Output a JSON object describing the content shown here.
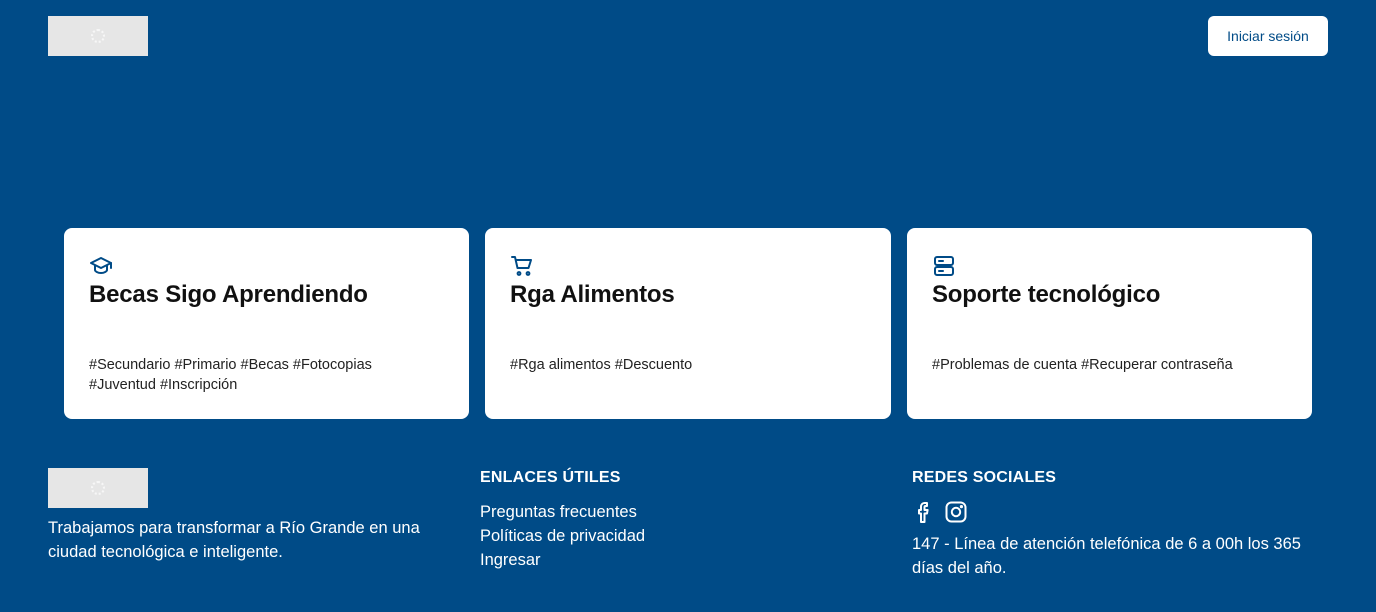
{
  "header": {
    "login_label": "Iniciar sesión"
  },
  "cards": [
    {
      "icon": "graduation-cap-icon",
      "title": "Becas Sigo Aprendiendo",
      "tags": "#Secundario #Primario #Becas #Fotocopias #Juventud #Inscripción"
    },
    {
      "icon": "shopping-cart-icon",
      "title": "Rga Alimentos",
      "tags": "#Rga alimentos #Descuento"
    },
    {
      "icon": "server-icon",
      "title": "Soporte tecnológico",
      "tags": "#Problemas de cuenta #Recuperar contraseña"
    }
  ],
  "footer": {
    "description": "Trabajamos para transformar a Río Grande en una ciudad tecnológica e inteligente.",
    "links_heading": "ENLACES ÚTILES",
    "links": [
      "Preguntas frecuentes",
      "Políticas de privacidad",
      "Ingresar"
    ],
    "social_heading": "REDES SOCIALES",
    "social_icons": [
      "facebook-icon",
      "instagram-icon"
    ],
    "phone_text": "147 - Línea de atención telefónica de 6 a 00h los 365 días del año."
  },
  "colors": {
    "background": "#004b87",
    "card_background": "#ffffff",
    "accent": "#004b87",
    "logo_placeholder": "#e6e6e6"
  }
}
